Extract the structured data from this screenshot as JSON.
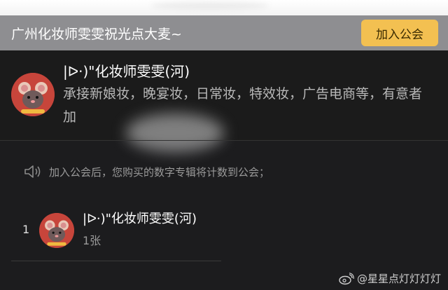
{
  "header": {
    "title": "广州化妆师雯雯祝光点大麦~",
    "join_button": "加入公会"
  },
  "guild": {
    "name": "|ᐅ·)\"化妆师雯雯(河)",
    "description": "承接新娘妆，晚宴妆，日常妆，特效妆，广告电商等，有意者加",
    "avatar_icon": "mouse-avatar-icon"
  },
  "notice": {
    "text": "加入公会后，您购买的数字专辑将计数到公会；",
    "icon": "speaker-icon"
  },
  "members": [
    {
      "rank": "1",
      "name": "|ᐅ·)\"化妆师雯雯(河)",
      "count": "1张"
    }
  ],
  "watermark": {
    "text": "@星星点灯灯灯灯",
    "icon": "weibo-icon"
  },
  "colors": {
    "background": "#1c1c1e",
    "header": "#8e8e91",
    "accent": "#f3c051",
    "avatar": "#c7453b"
  }
}
